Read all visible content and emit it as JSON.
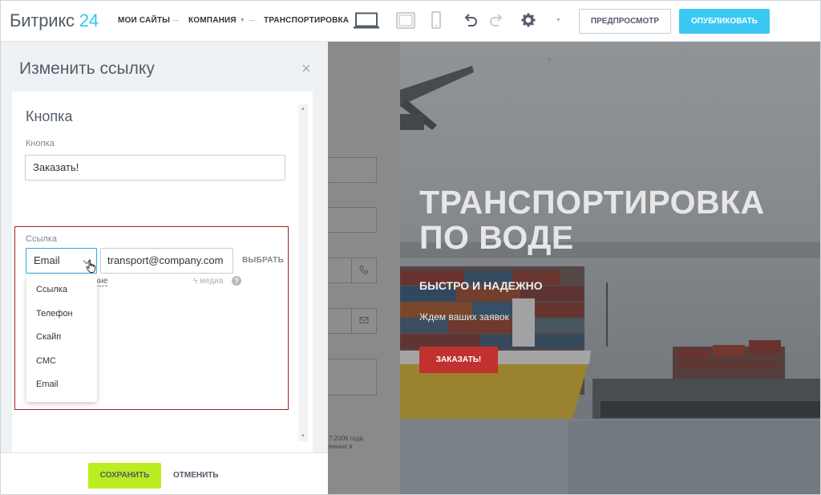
{
  "topbar": {
    "logo_text": "Битрикс",
    "logo_number": "24",
    "nav": [
      {
        "label": "МОИ САЙТЫ"
      },
      {
        "label": "КОМПАНИЯ"
      },
      {
        "label": "ТРАНСПОРТИРОВКА"
      }
    ],
    "preview_label": "ПРЕДПРОСМОТР",
    "publish_label": "ОПУБЛИКОВАТЬ",
    "icons": [
      "desktop-icon",
      "tablet-icon",
      "mobile-icon",
      "undo-icon",
      "redo-icon",
      "gear-icon",
      "chevron-down-icon"
    ]
  },
  "panel": {
    "title": "Изменить ссылку",
    "close_glyph": "×",
    "section_title": "Кнопка",
    "button_label": "Кнопка",
    "button_value": "Заказать!",
    "link": {
      "label": "Ссылка",
      "type_value": "Email",
      "value": "transport@company.com",
      "choose_label": "ВЫБРАТЬ",
      "new_window_partial": "кне",
      "media_label": "медиа",
      "help_glyph": "?",
      "options": [
        "Ссылка",
        "Телефон",
        "Скайп",
        "СМС",
        "Email"
      ]
    },
    "save_label": "СОХРАНИТЬ",
    "cancel_label": "ОТМЕНИТЬ"
  },
  "background_page": {
    "hero_title": "ТРАНСПОРТИРОВКА ПО ВОДЕ",
    "hero_subtitle": "БЫСТРО И НАДЕЖНО",
    "hero_text": "Ждем ваших заявок",
    "hero_button": "ЗАКАЗАТЬ!",
    "hero_question": "?",
    "form_text_1": "7.2006 года",
    "form_text_2": "енных в"
  },
  "colors": {
    "accent_blue": "#2fc6f6",
    "publish_blue": "#3bc8f5",
    "save_green": "#bbed21",
    "highlight_red": "#a71f26",
    "hero_button_red": "#c0312f"
  }
}
